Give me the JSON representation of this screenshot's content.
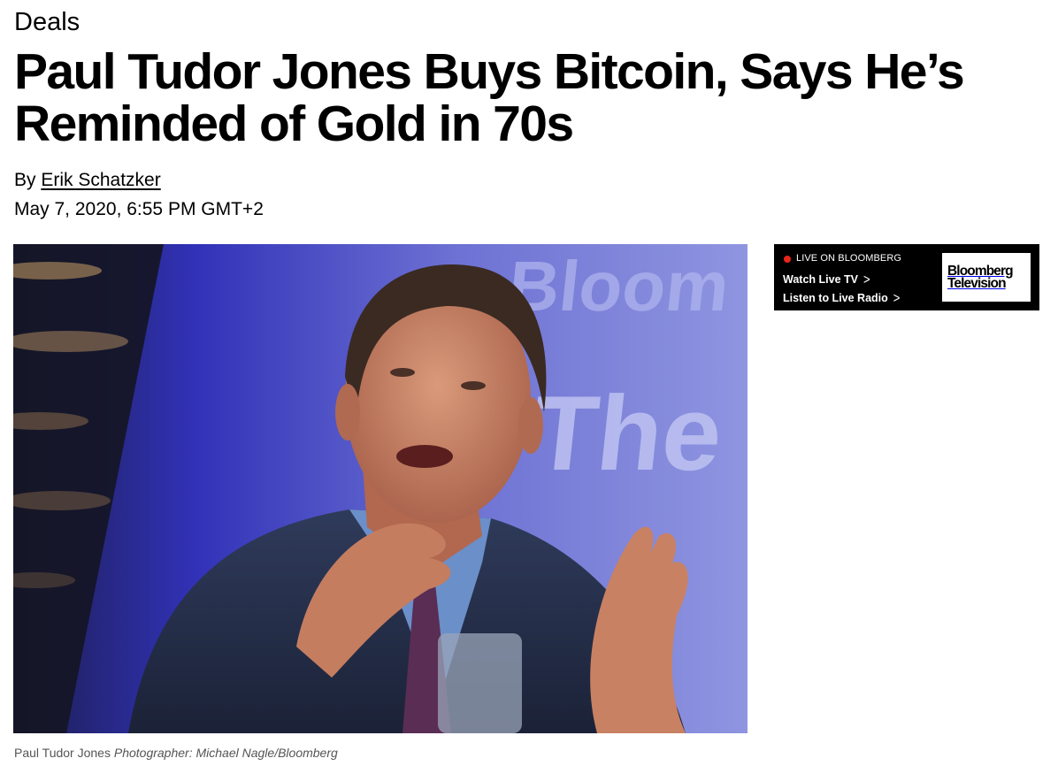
{
  "article": {
    "section": "Deals",
    "headline": "Paul Tudor Jones Buys Bitcoin, Says He’s Reminded of Gold in 70s",
    "byline_prefix": "By",
    "author": "Erik Schatzker",
    "date": "May 7, 2020, 6:55 PM GMT+2"
  },
  "image": {
    "backdrop_text_1": "Bloom",
    "backdrop_text_2": "The",
    "caption": "Paul Tudor Jones",
    "credit": "Photographer: Michael Nagle/Bloomberg"
  },
  "live_widget": {
    "label": "LIVE ON BLOOMBERG",
    "watch_tv": "Watch Live TV",
    "listen_radio": "Listen to Live Radio",
    "chevron": ">",
    "logo_line1": "Bloomberg",
    "logo_line2": "Television",
    "dot_color": "#e8261b"
  }
}
